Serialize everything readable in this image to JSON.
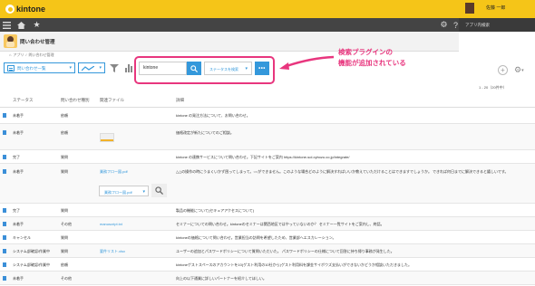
{
  "header": {
    "logo_text": "kintone",
    "user_name": "佐藤 一郎",
    "side_panel_label": "アプリ内検索"
  },
  "app": {
    "title": "問い合わせ管理",
    "breadcrumb": [
      "アプリ",
      "問い合わせ管理"
    ]
  },
  "toolbar": {
    "view_label": "問い合わせ一覧",
    "search_value": "kintone",
    "status_select_label": "ステータスを検索",
    "more_label": "•••"
  },
  "annotation": {
    "line1": "検索プラグインの",
    "line2": "機能が追加されている"
  },
  "pagination": "1 - 20（20件中）",
  "table": {
    "columns": [
      "ステータス",
      "問い合わせ種別",
      "関連ファイル",
      "詳細"
    ],
    "rows": [
      {
        "status": "未着手",
        "type": "依頼",
        "file": "",
        "detail": "kintone の発注方法について、お問い合わせ。"
      },
      {
        "status": "未着手",
        "type": "依頼",
        "file": "",
        "detail": "価格改定が新たについてのご相談。"
      },
      {
        "status": "完了",
        "type": "質問",
        "file": "",
        "detail": "kintone の連携サービスについて問い合わせ。下記サイトをご案内 https://kintone-sol.cybozu.co.jp/integrate/"
      },
      {
        "status": "未着手",
        "type": "質問",
        "file": "業務フロー図.pdf",
        "detail": "△△の操作の時にうまくいかず困ってしまって。○○ができません。このような場合どのように解決すればいいか教えていただけることはできますでしょうか。 できれば何日までに解決できると嬉しいです。"
      },
      {
        "status": "完了",
        "type": "質問",
        "file": "",
        "detail": "製品の機能について(セキュアアクセスについて)"
      },
      {
        "status": "未着手",
        "type": "その他",
        "file": "manuscript.txt",
        "detail": "セミナーについての問い合わせ。kintoneのセミナーは関西地区ではやっていないのか？ セミナー一覧サイトをご案内し、終話。"
      },
      {
        "status": "キャンセル",
        "type": "質問",
        "file": "",
        "detail": "kintoneの価格について問い合わせ。営業担当の訪問を希望したため、営業部へエスカレーション。"
      },
      {
        "status": "システム部確認/作業中",
        "type": "質問",
        "file": "要件リスト.xlsx",
        "detail": "ユーザーの追加とパスワードポリシーについて質問いただいた。 パスワードポリシーの仕様について回答に持ち帰り事務が発生した。"
      },
      {
        "status": "システム部確認/作業中",
        "type": "依頼",
        "file": "",
        "detail": "kintoneゲストスペースのアカウントを10(ゲスト利用の10社から)ゲスト利用料を課金サイボウズ支払いができないかどうか相談いただきました。"
      },
      {
        "status": "未着手",
        "type": "その他",
        "file": "",
        "detail": "向上の以下通業に詳しいパートナーを紹介してほしい。"
      }
    ],
    "inline_select_label": "業務フロー図.pdf"
  }
}
